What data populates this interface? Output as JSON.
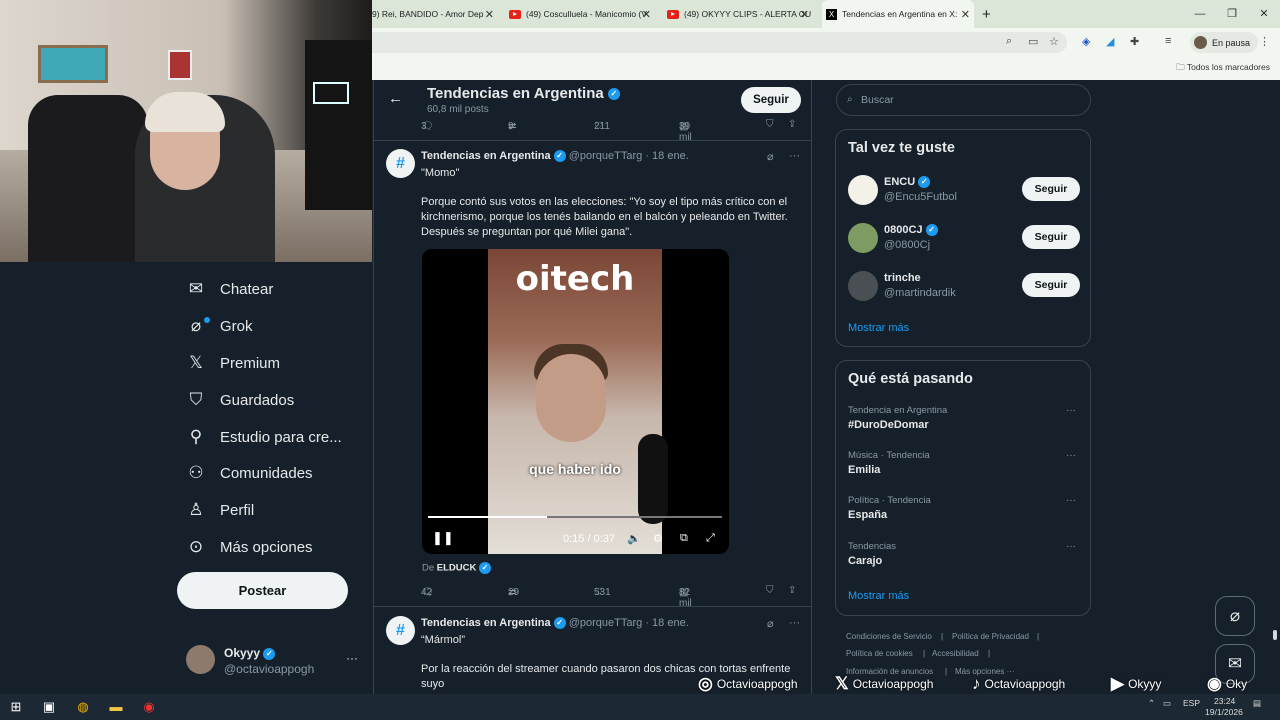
{
  "browser": {
    "tabs": [
      {
        "title": "9) Rei, BANDIDO - Amor Dep",
        "icon": "none"
      },
      {
        "title": "(49) Cosculluela - Manicomio (V",
        "icon": "youtube-icon"
      },
      {
        "title": "(49) OKYYY CLIPS - ALERTA CU",
        "icon": "youtube-icon"
      },
      {
        "title": "Tendencias en Argentina en X:",
        "icon": "x-icon"
      }
    ],
    "new_tab": "+",
    "profile_status": "En pausa",
    "bookmarks_label": "Todos los marcadores"
  },
  "nav": {
    "items": [
      {
        "label": "Chatear",
        "icon": "mail-icon"
      },
      {
        "label": "Grok",
        "icon": "grok-icon"
      },
      {
        "label": "Premium",
        "icon": "x-logo-icon"
      },
      {
        "label": "Guardados",
        "icon": "bookmark-icon"
      },
      {
        "label": "Estudio para cre...",
        "icon": "studio-icon"
      },
      {
        "label": "Comunidades",
        "icon": "communities-icon"
      },
      {
        "label": "Perfil",
        "icon": "person-icon"
      },
      {
        "label": "Más opciones",
        "icon": "more-circle-icon"
      }
    ],
    "post_button": "Postear",
    "account": {
      "name": "Okyyy",
      "handle": "@octavioappogh",
      "more": "···"
    }
  },
  "header": {
    "title": "Tendencias en Argentina",
    "posts": "60,8 mil posts",
    "follow": "Seguir"
  },
  "prev_actions": {
    "replies": "3",
    "reposts": "9",
    "likes": "211",
    "views": "39 mil"
  },
  "tweets": [
    {
      "name": "Tendencias en Argentina",
      "handle": "@porqueTTarg",
      "date": "· 18 ene.",
      "title": "\"Momo\"",
      "body": "Porque contó sus votos en las elecciones: \"Yo soy el tipo más crítico con el kirchnerismo, porque los tenés bailando en el balcón y peleando en Twitter. Después se preguntan por qué Milei gana\".",
      "video": {
        "logo": "oitech",
        "caption": "que haber ido",
        "time": "0:15 / 0:37",
        "progress": 0.405
      },
      "from_prefix": "De",
      "from_account": "ELDUCK",
      "actions": {
        "replies": "42",
        "reposts": "29",
        "likes": "531",
        "views": "82 mil"
      }
    },
    {
      "name": "Tendencias en Argentina",
      "handle": "@porqueTTarg",
      "date": "· 18 ene.",
      "title": "“Mármol”",
      "body": "Por la reacción del streamer cuando pasaron dos chicas con tortas enfrente suyo"
    }
  ],
  "sidebar": {
    "search_placeholder": "Buscar",
    "suggest_title": "Tal vez te guste",
    "suggestions": [
      {
        "name": "ENCU",
        "handle": "@Encu5Futbol",
        "button": "Seguir"
      },
      {
        "name": "0800CJ",
        "handle": "@0800Cj",
        "button": "Seguir"
      },
      {
        "name": "trinche",
        "handle": "@martindardik",
        "button": "Seguir"
      }
    ],
    "show_more": "Mostrar más",
    "trends_title": "Qué está pasando",
    "trends": [
      {
        "context": "Tendencia en Argentina",
        "name": "#DuroDeDomar"
      },
      {
        "context": "Música · Tendencia",
        "name": "Emilia"
      },
      {
        "context": "Política · Tendencia",
        "name": "España"
      },
      {
        "context": "Tendencias",
        "name": "Carajo"
      }
    ],
    "trends_more": "Mostrar más",
    "footer": {
      "terms": "Condiciones de Servicio",
      "privacy": "Política de Privacidad",
      "cookies": "Política de cookies",
      "accessibility": "Accesibilidad",
      "ads": "Información de anuncios",
      "more": "Más opciones ···"
    }
  },
  "overlay_socials": [
    {
      "icon": "instagram-icon",
      "label": "Octavioappogh"
    },
    {
      "icon": "x-logo-icon",
      "label": "Octavioappogh"
    },
    {
      "icon": "tiktok-icon",
      "label": "Octavioappogh"
    },
    {
      "icon": "youtube-icon",
      "label": "Okyyy"
    },
    {
      "icon": "spotify-icon",
      "label": "Oky"
    }
  ],
  "taskbar": {
    "lang": "ESP",
    "time": "23:24",
    "date": "19/1/2026"
  }
}
